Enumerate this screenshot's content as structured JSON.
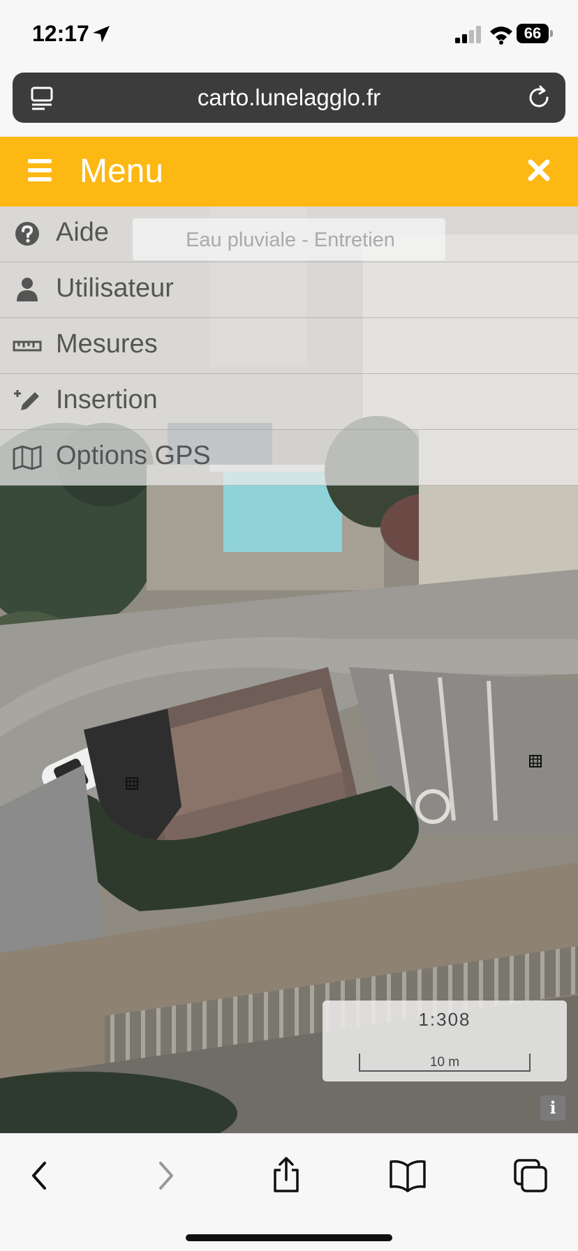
{
  "status_bar": {
    "time": "12:17",
    "battery": "66"
  },
  "browser": {
    "url": "carto.lunelagglo.fr"
  },
  "menu": {
    "title": "Menu",
    "items": [
      {
        "label": "Aide",
        "icon": "help-icon"
      },
      {
        "label": "Utilisateur",
        "icon": "user-icon"
      },
      {
        "label": "Mesures",
        "icon": "ruler-icon"
      },
      {
        "label": "Insertion",
        "icon": "edit-icon"
      },
      {
        "label": "Options GPS",
        "icon": "map-icon"
      }
    ]
  },
  "search": {
    "placeholder": "Eau pluviale - Entretien"
  },
  "scale": {
    "ratio": "1:308",
    "distance": "10 m"
  },
  "info_button": {
    "label": "i"
  },
  "colors": {
    "menu_header": "#fdb813",
    "url_bar": "#3c3c3c"
  }
}
